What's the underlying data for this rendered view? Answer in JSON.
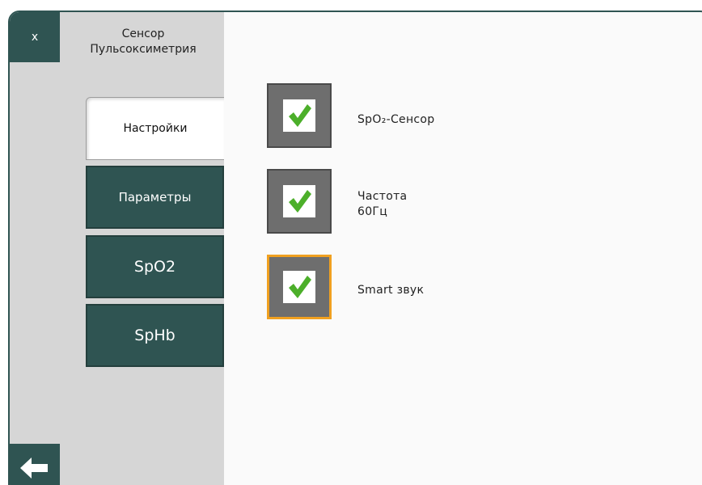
{
  "header": {
    "close_label": "x",
    "title_line1": "Сенсор",
    "title_line2": "Пульсоксиметрия"
  },
  "tabs": [
    {
      "label": "Настройки",
      "active": true
    },
    {
      "label": "Параметры",
      "active": false
    },
    {
      "label": "SpO2",
      "active": false
    },
    {
      "label": "SpHb",
      "active": false
    }
  ],
  "options": [
    {
      "label_line1": "SpO₂-Сенсор",
      "label_line2": "",
      "checked": true,
      "focused": false
    },
    {
      "label_line1": "Частота",
      "label_line2": "60Гц",
      "checked": true,
      "focused": false
    },
    {
      "label_line1": "Smart звук",
      "label_line2": "",
      "checked": true,
      "focused": true
    }
  ],
  "colors": {
    "teal": "#2f5452",
    "sidebar": "#d6d6d6",
    "checkbox_bg": "#6e6e6e",
    "check_green": "#4caf2a",
    "focus_orange": "#f0a020"
  },
  "icons": {
    "close": "close-icon",
    "back": "back-arrow-icon",
    "check": "checkmark-icon"
  }
}
